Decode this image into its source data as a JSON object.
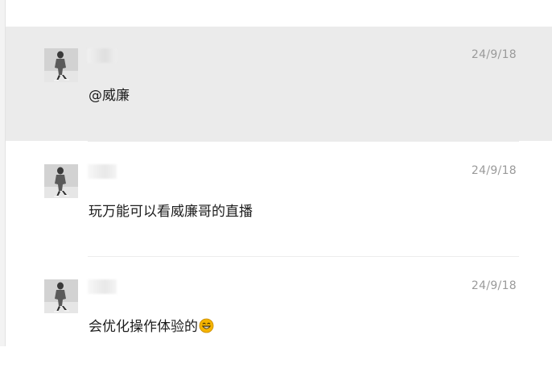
{
  "messages": [
    {
      "time": "24/9/18",
      "text": "@威廉",
      "highlighted": true,
      "emoji": ""
    },
    {
      "time": "24/9/18",
      "text": "玩万能可以看威廉哥的直播",
      "highlighted": false,
      "emoji": ""
    },
    {
      "time": "24/9/18",
      "text": "会优化操作体验的",
      "highlighted": false,
      "emoji": "grinning-face-emoji"
    }
  ],
  "colors": {
    "highlight_bg": "#ebebeb",
    "timestamp": "#9a9a9a",
    "text": "#1c1c1c",
    "emoji": "#f5b400"
  }
}
